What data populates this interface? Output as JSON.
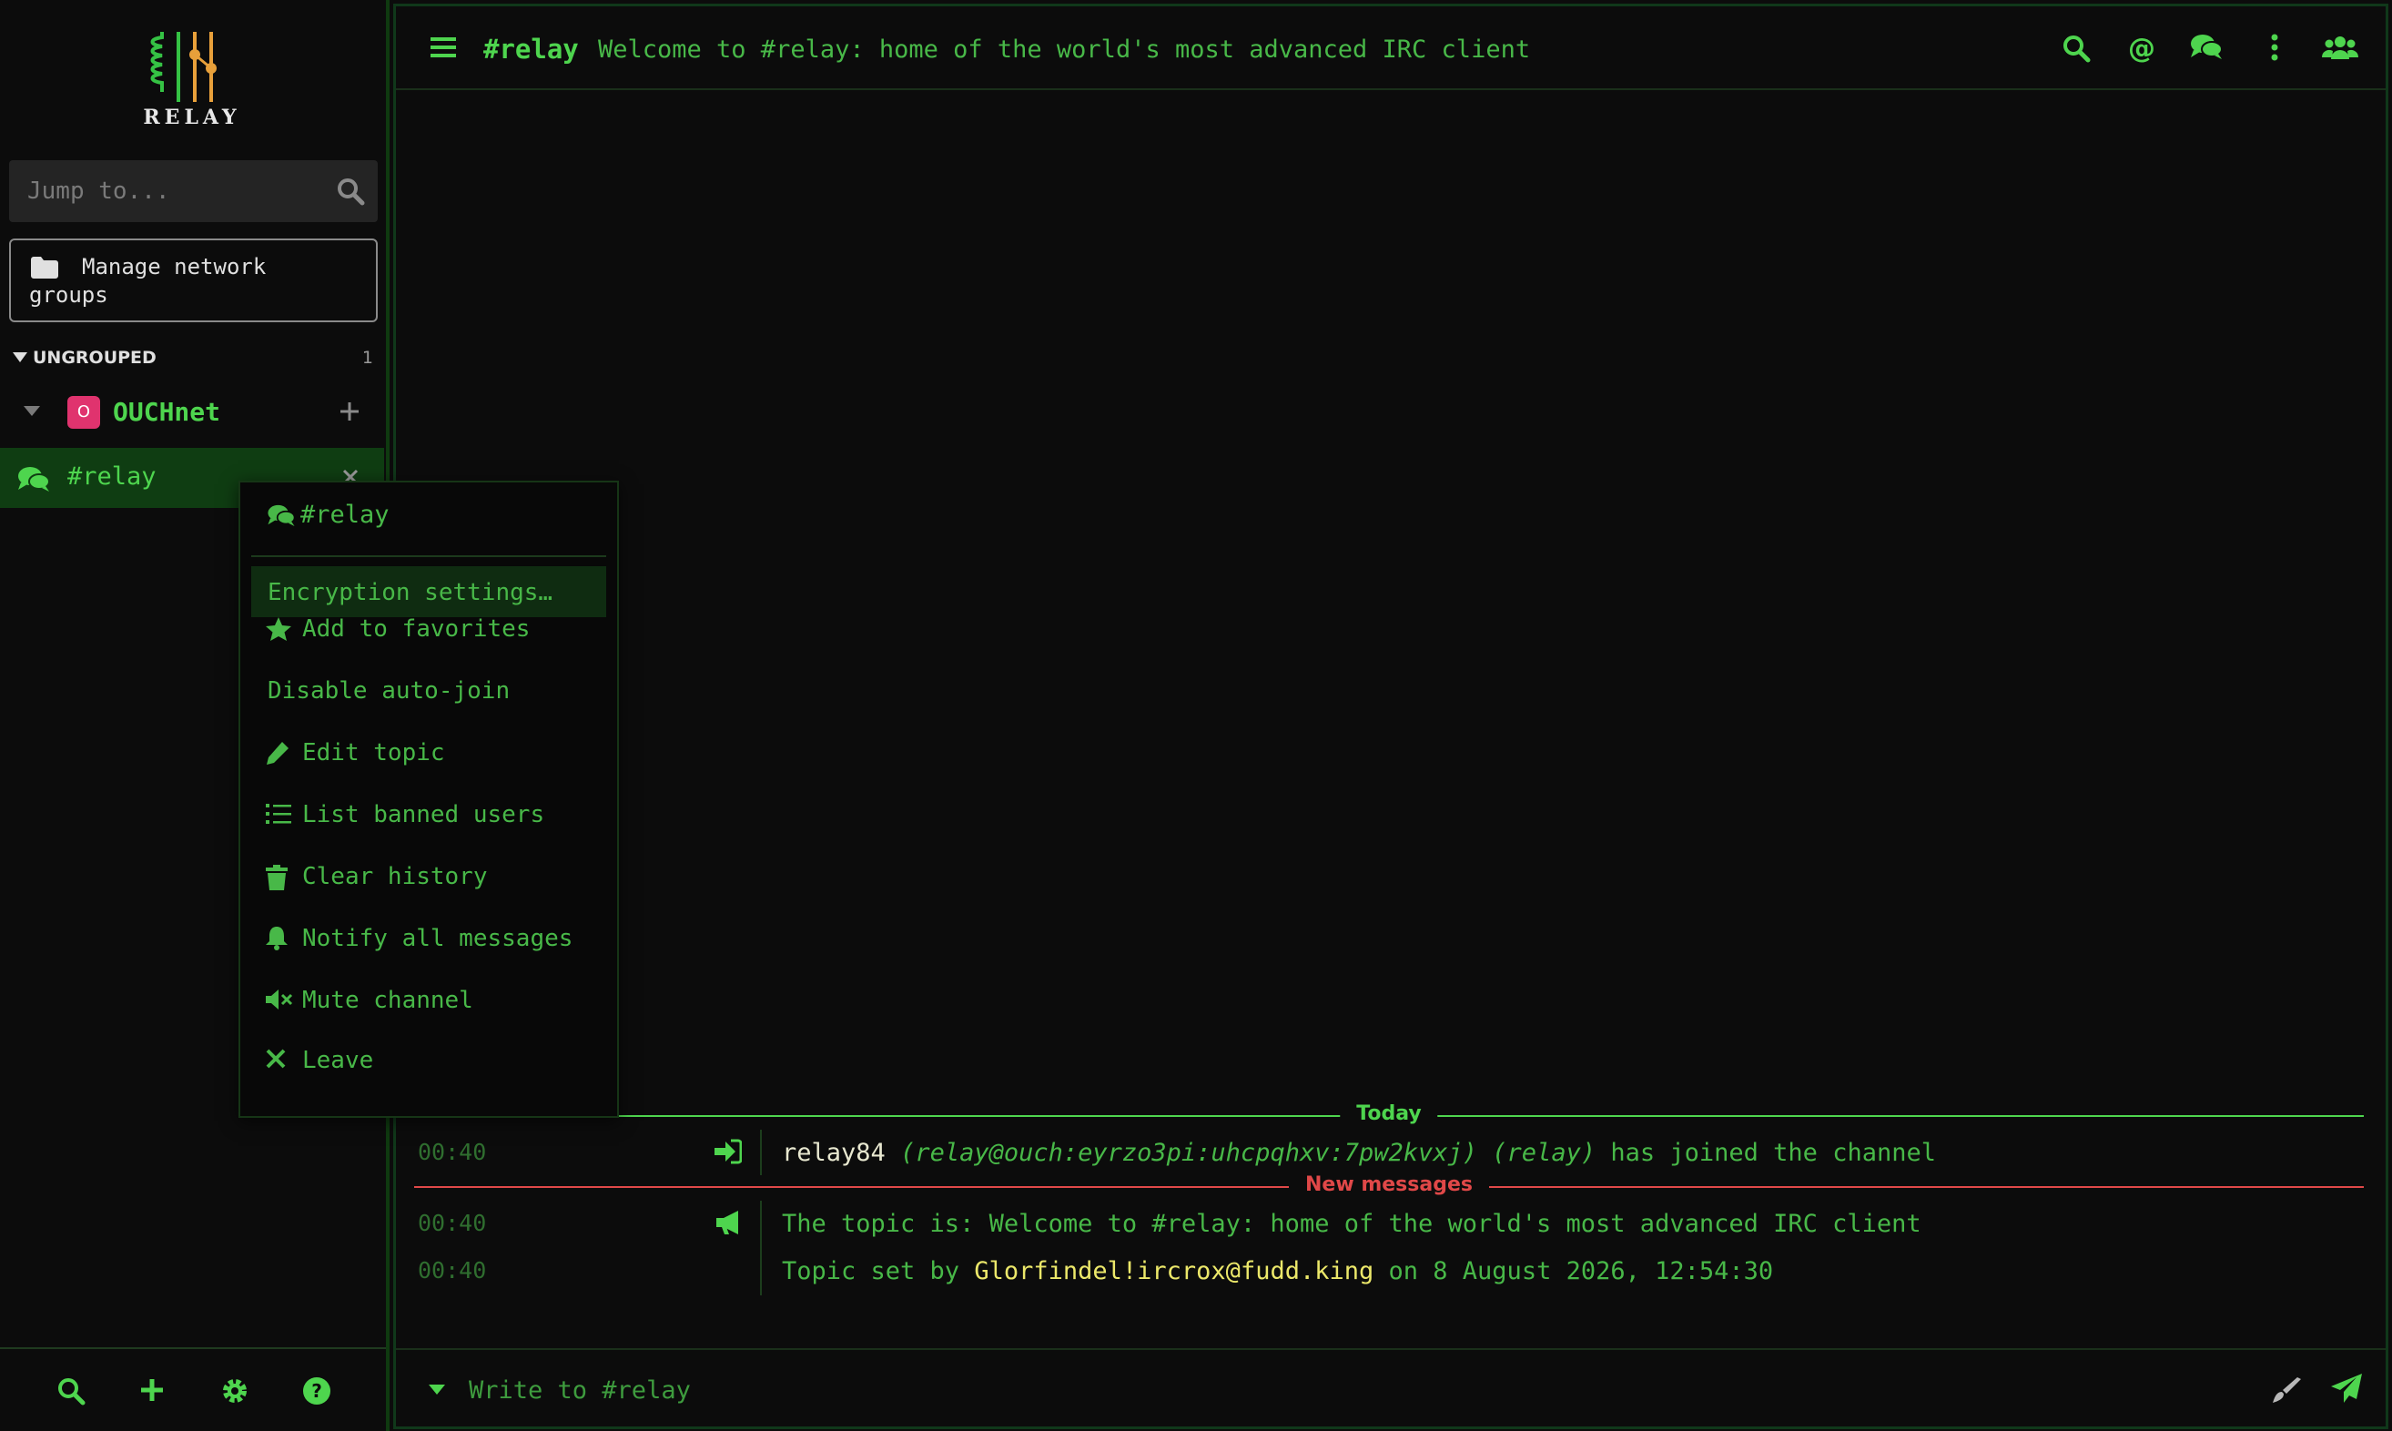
{
  "app": {
    "logo_text": "RELAY"
  },
  "colors": {
    "accent": "#4ed54e",
    "background": "#0c0c0c",
    "new_messages": "#e04848",
    "network_badge": "#e0336e",
    "highlight": "#ece86a"
  },
  "sidebar": {
    "jump_placeholder": "Jump to...",
    "manage_groups_label": "Manage network groups",
    "group": {
      "label": "UNGROUPED",
      "count": "1"
    },
    "network": {
      "badge": "O",
      "name": "OUCHnet"
    },
    "channel": {
      "name": "#relay"
    },
    "footer_icons": [
      "search-icon",
      "plus-icon",
      "gear-icon",
      "help-icon"
    ]
  },
  "header": {
    "channel": "#relay",
    "topic": "Welcome to #relay: home of the world's most advanced IRC client",
    "icons": [
      "search-icon",
      "mention-icon",
      "comments-icon",
      "more-vertical-icon",
      "users-icon"
    ]
  },
  "messages": {
    "today_label": "Today",
    "new_messages_label": "New messages",
    "join": {
      "time": "00:40",
      "nick": "relay84",
      "host": "(relay@ouch:eyrzo3pi:uhcpqhxv:7pw2kvxj)",
      "realname": "(relay)",
      "action": "has joined the channel"
    },
    "topic": {
      "time": "00:40",
      "text": "The topic is: Welcome to #relay: home of the world's most advanced IRC client"
    },
    "topic_set": {
      "time": "00:40",
      "prefix": "Topic set by",
      "by": "Glorfindel!ircrox@fudd.king",
      "suffix": "on 8 August 2026, 12:54:30"
    }
  },
  "compose": {
    "placeholder": "Write to #relay"
  },
  "context_menu": {
    "title": "#relay",
    "items": [
      {
        "label": "Encryption settings…",
        "icon": ""
      },
      {
        "label": "Add to favorites",
        "icon": "star-icon"
      },
      {
        "label": "Disable auto-join",
        "icon": ""
      },
      {
        "label": "Edit topic",
        "icon": "pencil-icon"
      },
      {
        "label": "List banned users",
        "icon": "list-icon"
      },
      {
        "label": "Clear history",
        "icon": "trash-icon"
      },
      {
        "label": "Notify all messages",
        "icon": "bell-icon"
      },
      {
        "label": "Mute channel",
        "icon": "volume-mute-icon"
      },
      {
        "label": "Leave",
        "icon": "close-icon"
      }
    ]
  }
}
